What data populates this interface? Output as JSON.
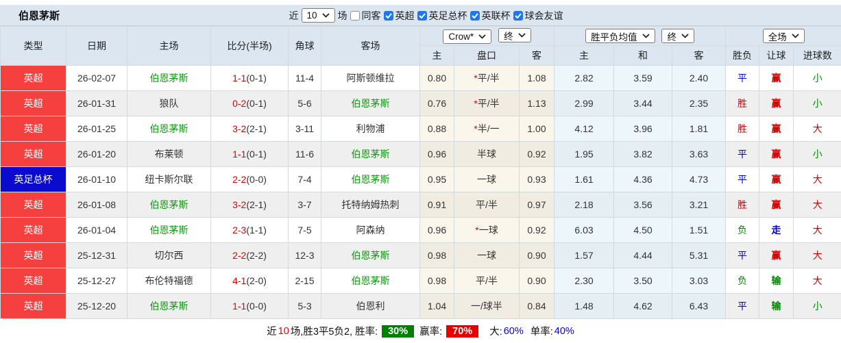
{
  "title": "伯恩茅斯",
  "controls": {
    "near_label": "近",
    "match_count": "10",
    "matches_label": "场",
    "same_away": {
      "label": "同客",
      "checked": false
    },
    "leagues": [
      {
        "label": "英超",
        "checked": true
      },
      {
        "label": "英足总杯",
        "checked": true
      },
      {
        "label": "英联杯",
        "checked": true
      },
      {
        "label": "球会友谊",
        "checked": true
      }
    ]
  },
  "table": {
    "columns": {
      "type": "类型",
      "date": "日期",
      "home": "主场",
      "score": "比分(半场)",
      "corner": "角球",
      "away": "客场"
    },
    "selects": {
      "odds_company": "Crow*",
      "odds_time": "终",
      "avg_type": "胜平负均值",
      "avg_time": "终",
      "result_scope": "全场"
    },
    "sub_columns": {
      "odds_home": "主",
      "handicap": "盘口",
      "odds_away": "客",
      "avg_home": "主",
      "avg_draw": "和",
      "avg_away": "客",
      "wdl": "胜负",
      "let_ball": "让球",
      "goals": "进球数"
    }
  },
  "rows": [
    {
      "type": "英超",
      "type_color": "red",
      "date": "26-02-07",
      "home": "伯恩茅斯",
      "home_green": true,
      "score": "1-1",
      "half": "(0-1)",
      "corner": "11-4",
      "away": "阿斯顿维拉",
      "away_green": false,
      "odds_home": "0.80",
      "handicap_star": true,
      "handicap": "平/半",
      "odds_away": "1.08",
      "avg_home": "2.82",
      "avg_draw": "3.59",
      "avg_away": "2.40",
      "wdl": "平",
      "wdl_color": "blue",
      "let": "赢",
      "let_color": "red",
      "goals": "小",
      "goals_color": "green"
    },
    {
      "type": "英超",
      "type_color": "red",
      "date": "26-01-31",
      "home": "狼队",
      "home_green": false,
      "score": "0-2",
      "half": "(0-1)",
      "corner": "5-6",
      "away": "伯恩茅斯",
      "away_green": true,
      "odds_home": "0.76",
      "handicap_star": true,
      "handicap": "平/半",
      "odds_away": "1.13",
      "avg_home": "2.99",
      "avg_draw": "3.44",
      "avg_away": "2.35",
      "wdl": "胜",
      "wdl_color": "red",
      "let": "赢",
      "let_color": "red",
      "goals": "小",
      "goals_color": "green"
    },
    {
      "type": "英超",
      "type_color": "red",
      "date": "26-01-25",
      "home": "伯恩茅斯",
      "home_green": true,
      "score": "3-2",
      "half": "(2-1)",
      "corner": "3-11",
      "away": "利物浦",
      "away_green": false,
      "odds_home": "0.88",
      "handicap_star": true,
      "handicap": "半/一",
      "odds_away": "1.00",
      "avg_home": "4.12",
      "avg_draw": "3.96",
      "avg_away": "1.81",
      "wdl": "胜",
      "wdl_color": "red",
      "let": "赢",
      "let_color": "red",
      "goals": "大",
      "goals_color": "red"
    },
    {
      "type": "英超",
      "type_color": "red",
      "date": "26-01-20",
      "home": "布莱顿",
      "home_green": false,
      "score": "1-1",
      "half": "(0-1)",
      "corner": "11-6",
      "away": "伯恩茅斯",
      "away_green": true,
      "odds_home": "0.96",
      "handicap_star": false,
      "handicap": "半球",
      "odds_away": "0.92",
      "avg_home": "1.95",
      "avg_draw": "3.82",
      "avg_away": "3.63",
      "wdl": "平",
      "wdl_color": "blue",
      "let": "赢",
      "let_color": "red",
      "goals": "小",
      "goals_color": "green"
    },
    {
      "type": "英足总杯",
      "type_color": "blue",
      "date": "26-01-10",
      "home": "纽卡斯尔联",
      "home_green": false,
      "score": "2-2",
      "half": "(0-0)",
      "corner": "7-4",
      "away": "伯恩茅斯",
      "away_green": true,
      "odds_home": "0.95",
      "handicap_star": false,
      "handicap": "一球",
      "odds_away": "0.93",
      "avg_home": "1.61",
      "avg_draw": "4.36",
      "avg_away": "4.73",
      "wdl": "平",
      "wdl_color": "blue",
      "let": "赢",
      "let_color": "red",
      "goals": "大",
      "goals_color": "red"
    },
    {
      "type": "英超",
      "type_color": "red",
      "date": "26-01-08",
      "home": "伯恩茅斯",
      "home_green": true,
      "score": "3-2",
      "half": "(2-1)",
      "corner": "3-7",
      "away": "托特纳姆热刺",
      "away_green": false,
      "odds_home": "0.91",
      "handicap_star": false,
      "handicap": "平/半",
      "odds_away": "0.97",
      "avg_home": "2.18",
      "avg_draw": "3.56",
      "avg_away": "3.21",
      "wdl": "胜",
      "wdl_color": "red",
      "let": "赢",
      "let_color": "red",
      "goals": "大",
      "goals_color": "red"
    },
    {
      "type": "英超",
      "type_color": "red",
      "date": "26-01-04",
      "home": "伯恩茅斯",
      "home_green": true,
      "score": "2-3",
      "half": "(1-1)",
      "corner": "7-5",
      "away": "阿森纳",
      "away_green": false,
      "odds_home": "0.96",
      "handicap_star": true,
      "handicap": "一球",
      "odds_away": "0.92",
      "avg_home": "6.03",
      "avg_draw": "4.50",
      "avg_away": "1.51",
      "wdl": "负",
      "wdl_color": "green",
      "let": "走",
      "let_color": "blue",
      "goals": "大",
      "goals_color": "red"
    },
    {
      "type": "英超",
      "type_color": "red",
      "date": "25-12-31",
      "home": "切尔西",
      "home_green": false,
      "score": "2-2",
      "half": "(2-2)",
      "corner": "12-3",
      "away": "伯恩茅斯",
      "away_green": true,
      "odds_home": "0.98",
      "handicap_star": false,
      "handicap": "一球",
      "odds_away": "0.90",
      "avg_home": "1.57",
      "avg_draw": "4.44",
      "avg_away": "5.31",
      "wdl": "平",
      "wdl_color": "blue",
      "let": "赢",
      "let_color": "red",
      "goals": "大",
      "goals_color": "red"
    },
    {
      "type": "英超",
      "type_color": "red",
      "date": "25-12-27",
      "home": "布伦特福德",
      "home_green": false,
      "score": "4-1",
      "half": "(2-0)",
      "corner": "2-15",
      "away": "伯恩茅斯",
      "away_green": true,
      "odds_home": "0.98",
      "handicap_star": false,
      "handicap": "平/半",
      "odds_away": "0.90",
      "avg_home": "2.30",
      "avg_draw": "3.50",
      "avg_away": "3.03",
      "wdl": "负",
      "wdl_color": "green",
      "let": "输",
      "let_color": "green",
      "goals": "大",
      "goals_color": "red"
    },
    {
      "type": "英超",
      "type_color": "red",
      "date": "25-12-20",
      "home": "伯恩茅斯",
      "home_green": true,
      "score": "1-1",
      "half": "(0-0)",
      "corner": "5-3",
      "away": "伯恩利",
      "away_green": false,
      "odds_home": "1.04",
      "handicap_star": false,
      "handicap": "一/球半",
      "odds_away": "0.84",
      "avg_home": "1.48",
      "avg_draw": "4.62",
      "avg_away": "6.43",
      "wdl": "平",
      "wdl_color": "blue",
      "let": "输",
      "let_color": "green",
      "goals": "小",
      "goals_color": "green"
    }
  ],
  "footer": {
    "near": "近",
    "count": "10",
    "summary": "场,胜3平5负2, 胜率:",
    "rate_value": "30%",
    "win_label": "赢率:",
    "win_value": "70%",
    "big_label": "大:",
    "big_value": "60%",
    "single_label": "单率:",
    "single_value": "40%"
  },
  "colors": {
    "league_red": "#f64040",
    "cup_blue": "#0b0bcf",
    "team_green": "#089b08",
    "score_red": "#e00000",
    "rate_green_bg": "#008000",
    "rate_red_bg": "#e80000",
    "value_blue": "#0000e0"
  }
}
